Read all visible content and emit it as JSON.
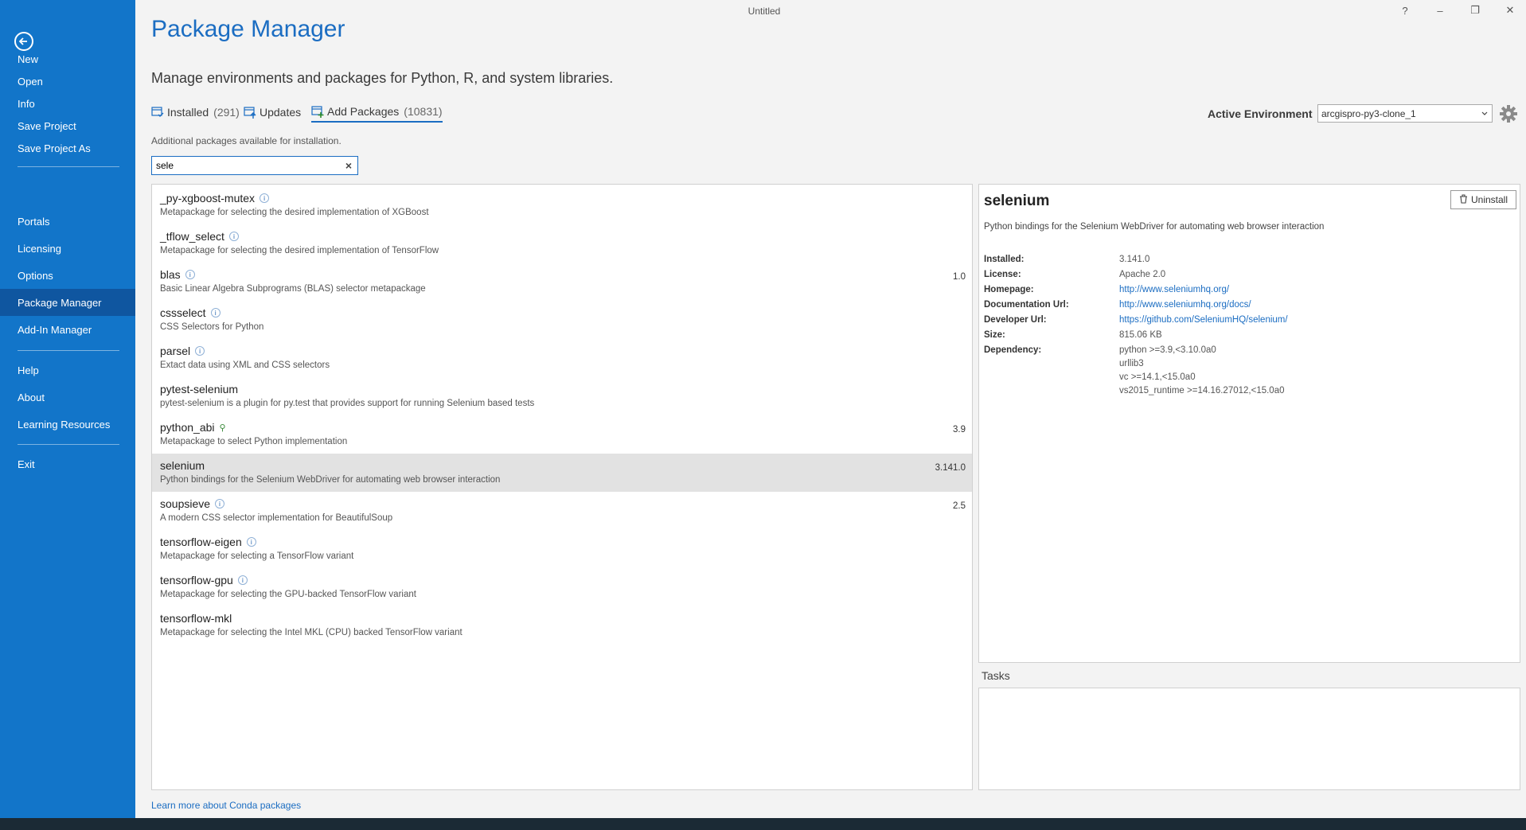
{
  "window": {
    "title": "Untitled",
    "help": "?",
    "minimize": "–",
    "restore": "❐",
    "close": "✕"
  },
  "sidebar": {
    "items": [
      {
        "label": "New"
      },
      {
        "label": "Open"
      },
      {
        "label": "Info"
      },
      {
        "label": "Save Project"
      },
      {
        "label": "Save Project As"
      },
      {
        "label": "Portals"
      },
      {
        "label": "Licensing"
      },
      {
        "label": "Options"
      },
      {
        "label": "Package Manager"
      },
      {
        "label": "Add-In Manager"
      },
      {
        "label": "Help"
      },
      {
        "label": "About"
      },
      {
        "label": "Learning Resources"
      },
      {
        "label": "Exit"
      }
    ],
    "active": "Package Manager"
  },
  "header": {
    "title": "Package Manager",
    "subtitle": "Manage environments and packages for Python, R, and system libraries."
  },
  "tabs": [
    {
      "label": "Installed",
      "count": "(291)"
    },
    {
      "label": "Updates",
      "count": ""
    },
    {
      "label": "Add Packages",
      "count": "(10831)"
    }
  ],
  "active_tab": "Add Packages",
  "environment": {
    "label": "Active Environment",
    "value": "arcgispro-py3-clone_1"
  },
  "additional_text": "Additional packages available for installation.",
  "search": {
    "value": "sele",
    "clear": "×"
  },
  "packages": [
    {
      "name": "_py-xgboost-mutex",
      "desc": "Metapackage for selecting the desired implementation of XGBoost",
      "version": "",
      "icon": "info-icon"
    },
    {
      "name": "_tflow_select",
      "desc": "Metapackage for selecting the desired implementation of TensorFlow",
      "version": "",
      "icon": "info-icon"
    },
    {
      "name": "blas",
      "desc": "Basic Linear Algebra Subprograms (BLAS) selector metapackage",
      "version": "1.0",
      "icon": "info-icon"
    },
    {
      "name": "cssselect",
      "desc": "CSS Selectors for Python",
      "version": "",
      "icon": "info-icon"
    },
    {
      "name": "parsel",
      "desc": "Extact data using XML and CSS selectors",
      "version": "",
      "icon": "info-icon"
    },
    {
      "name": "pytest-selenium",
      "desc": "pytest-selenium is a plugin for py.test that provides support for running Selenium based tests",
      "version": "",
      "icon": ""
    },
    {
      "name": "python_abi",
      "desc": "Metapackage to select Python implementation",
      "version": "3.9",
      "icon": "python-icon"
    },
    {
      "name": "selenium",
      "desc": "Python bindings for the Selenium WebDriver for automating web browser interaction",
      "version": "3.141.0",
      "icon": ""
    },
    {
      "name": "soupsieve",
      "desc": "A modern CSS selector implementation for BeautifulSoup",
      "version": "2.5",
      "icon": "info-icon"
    },
    {
      "name": "tensorflow-eigen",
      "desc": "Metapackage for selecting a TensorFlow variant",
      "version": "",
      "icon": "info-icon"
    },
    {
      "name": "tensorflow-gpu",
      "desc": "Metapackage for selecting the GPU-backed TensorFlow variant",
      "version": "",
      "icon": "info-icon"
    },
    {
      "name": "tensorflow-mkl",
      "desc": "Metapackage for selecting the Intel MKL (CPU) backed TensorFlow variant",
      "version": "",
      "icon": ""
    }
  ],
  "selected_package": "selenium",
  "detail": {
    "name": "selenium",
    "uninstall_label": "Uninstall",
    "description": "Python bindings for the Selenium WebDriver for automating web browser interaction",
    "installed_label": "Installed:",
    "installed": "3.141.0",
    "license_label": "License:",
    "license": "Apache 2.0",
    "homepage_label": "Homepage:",
    "homepage": "http://www.seleniumhq.org/",
    "doc_label": "Documentation Url:",
    "doc_url": "http://www.seleniumhq.org/docs/",
    "dev_label": "Developer Url:",
    "dev_url": "https://github.com/SeleniumHQ/selenium/",
    "size_label": "Size:",
    "size": "815.06 KB",
    "dependency_label": "Dependency:",
    "dependencies": [
      "python >=3.9,<3.10.0a0",
      "urllib3",
      "vc >=14.1,<15.0a0",
      "vs2015_runtime >=14.16.27012,<15.0a0"
    ]
  },
  "tasks_label": "Tasks",
  "learn_more": "Learn more about Conda packages",
  "colors": {
    "sidebar": "#1275c9",
    "sidebar_active": "#0f56a0",
    "accent": "#1b6dc2"
  }
}
